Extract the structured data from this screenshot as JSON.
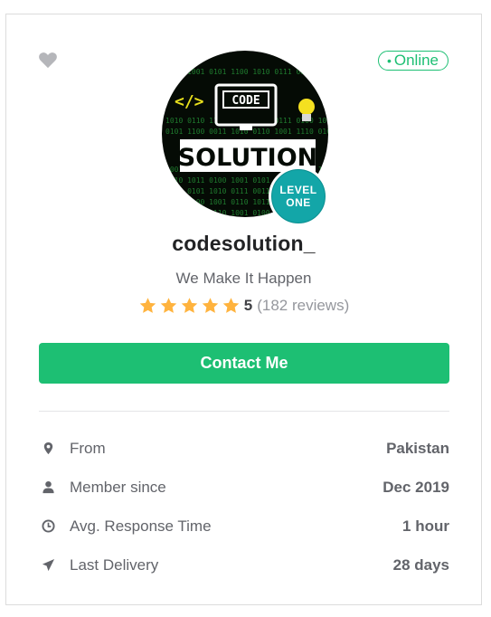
{
  "status": {
    "dot": "•",
    "label": "Online"
  },
  "avatar": {
    "logo_code": "CODE",
    "logo_solution": "SOLUTION",
    "logo_mark": "</>",
    "level_line1": "LEVEL",
    "level_line2": "ONE"
  },
  "profile": {
    "username": "codesolution_",
    "tagline": "We Make It Happen",
    "rating_score": "5",
    "rating_stars": 5,
    "reviews": "(182 reviews)"
  },
  "contact_button": {
    "label": "Contact Me"
  },
  "stats": [
    {
      "icon": "location-pin-icon",
      "label": "From",
      "value": "Pakistan"
    },
    {
      "icon": "user-icon",
      "label": "Member since",
      "value": "Dec 2019"
    },
    {
      "icon": "clock-icon",
      "label": "Avg. Response Time",
      "value": "1 hour"
    },
    {
      "icon": "paper-plane-icon",
      "label": "Last Delivery",
      "value": "28 days"
    }
  ],
  "colors": {
    "accent": "#1dbf73",
    "star": "#ffb33e",
    "badge": "#13a6a8",
    "heart": "#b5b6ba"
  }
}
